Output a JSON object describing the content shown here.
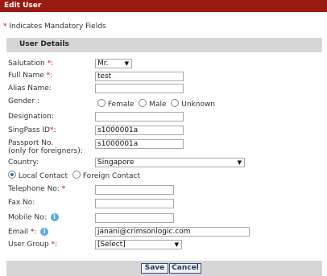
{
  "window": {
    "title": "Edit User"
  },
  "mandatory_note": {
    "star": "*",
    "text": " Indicates Mandatory Fields"
  },
  "section": {
    "title": "User Details"
  },
  "fields": {
    "salutation": {
      "label": "Salutation ",
      "star": "*",
      "colon": ":",
      "value": "Mr."
    },
    "full_name": {
      "label": "Full Name ",
      "star": "*",
      "colon": ":",
      "value": "test"
    },
    "alias_name": {
      "label": "Alias Name:",
      "value": ""
    },
    "gender": {
      "label": "Gender :",
      "options": [
        "Female",
        "Male",
        "Unknown"
      ],
      "selected": ""
    },
    "designation": {
      "label": "Designation:",
      "value": ""
    },
    "singpass_id": {
      "label": "SingPass  ID",
      "star": "*",
      "colon": ":",
      "value": "s1000001a"
    },
    "passport_no": {
      "label_line1": "Passport No.",
      "label_line2": "(only for foreigners):",
      "value": "s1000001a"
    },
    "country": {
      "label": "Country:",
      "value": "Singapore"
    },
    "contact_type": {
      "options": [
        "Local Contact",
        "Foreign Contact"
      ],
      "selected": "Local Contact"
    },
    "telephone": {
      "label": "Telephone No: ",
      "star": "*",
      "value": ""
    },
    "fax": {
      "label": "Fax No:",
      "value": ""
    },
    "mobile": {
      "label": "Mobile No:",
      "value": ""
    },
    "email": {
      "label": "Email ",
      "star": "*",
      "colon": ":",
      "value": "janani@crimsonlogic.com"
    },
    "user_group": {
      "label": "User Group ",
      "star": "*",
      "colon": ":",
      "value": "[Select]"
    }
  },
  "buttons": {
    "save": "Save",
    "cancel": "Cancel"
  },
  "icons": {
    "info": "info-icon",
    "info_color": "#5aa8e8"
  },
  "colors": {
    "titlebar": "#9a1a12",
    "section_bg": "#d6d6d6",
    "required": "#dd0000"
  }
}
